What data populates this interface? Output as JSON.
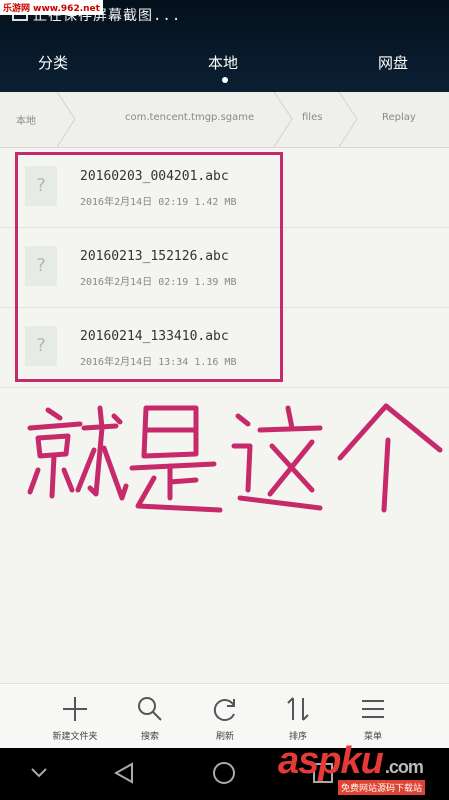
{
  "watermark": "乐游网 www.962.net",
  "status_text": "正在保存屏幕截图...",
  "tabs": [
    {
      "label": "分类"
    },
    {
      "label": "本地"
    },
    {
      "label": "网盘"
    }
  ],
  "breadcrumb": [
    "本地",
    "com.tencent.tmgp.sgame",
    "files",
    "Replay"
  ],
  "files": [
    {
      "name": "20160203_004201.abc",
      "date": "2016年2月14日",
      "time": "02:19",
      "size": "1.42 MB"
    },
    {
      "name": "20160213_152126.abc",
      "date": "2016年2月14日",
      "time": "02:19",
      "size": "1.39 MB"
    },
    {
      "name": "20160214_133410.abc",
      "date": "2016年2月14日",
      "time": "13:34",
      "size": "1.16 MB"
    }
  ],
  "file_icon_glyph": "?",
  "annotation_text": "就是这个",
  "annotation_color": "#c62a6b",
  "toolbar": [
    {
      "label": "新建文件夹",
      "icon": "plus-icon"
    },
    {
      "label": "搜索",
      "icon": "search-icon"
    },
    {
      "label": "刷新",
      "icon": "refresh-icon"
    },
    {
      "label": "排序",
      "icon": "sort-icon"
    },
    {
      "label": "菜单",
      "icon": "menu-icon"
    }
  ],
  "brand": {
    "name": "aspku",
    "tld": ".com",
    "sub": "免费网站源码下载站"
  }
}
